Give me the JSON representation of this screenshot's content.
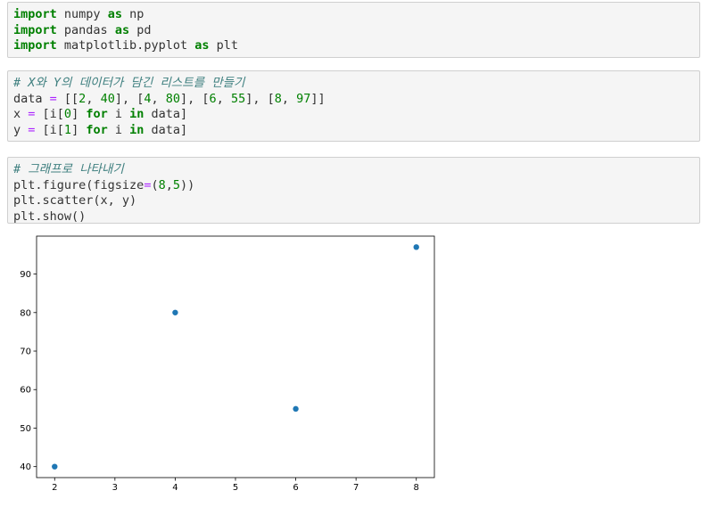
{
  "cells": [
    {
      "lines": [
        [
          {
            "t": "import",
            "c": "kw"
          },
          {
            "t": " numpy ",
            "c": "plain"
          },
          {
            "t": "as",
            "c": "kw"
          },
          {
            "t": " np",
            "c": "plain"
          }
        ],
        [
          {
            "t": "import",
            "c": "kw"
          },
          {
            "t": " pandas ",
            "c": "plain"
          },
          {
            "t": "as",
            "c": "kw"
          },
          {
            "t": " pd",
            "c": "plain"
          }
        ],
        [
          {
            "t": "import",
            "c": "kw"
          },
          {
            "t": " matplotlib.pyplot ",
            "c": "plain"
          },
          {
            "t": "as",
            "c": "kw"
          },
          {
            "t": " plt",
            "c": "plain"
          }
        ]
      ]
    },
    {
      "lines": [
        [
          {
            "t": "# X와 Y의 데이터가 담긴 리스트를 만들기",
            "c": "cmt"
          }
        ],
        [
          {
            "t": "data ",
            "c": "plain"
          },
          {
            "t": "=",
            "c": "op"
          },
          {
            "t": " [[",
            "c": "plain"
          },
          {
            "t": "2",
            "c": "num"
          },
          {
            "t": ", ",
            "c": "plain"
          },
          {
            "t": "40",
            "c": "num"
          },
          {
            "t": "], [",
            "c": "plain"
          },
          {
            "t": "4",
            "c": "num"
          },
          {
            "t": ", ",
            "c": "plain"
          },
          {
            "t": "80",
            "c": "num"
          },
          {
            "t": "], [",
            "c": "plain"
          },
          {
            "t": "6",
            "c": "num"
          },
          {
            "t": ", ",
            "c": "plain"
          },
          {
            "t": "55",
            "c": "num"
          },
          {
            "t": "], [",
            "c": "plain"
          },
          {
            "t": "8",
            "c": "num"
          },
          {
            "t": ", ",
            "c": "plain"
          },
          {
            "t": "97",
            "c": "num"
          },
          {
            "t": "]]",
            "c": "plain"
          }
        ],
        [
          {
            "t": "x ",
            "c": "plain"
          },
          {
            "t": "=",
            "c": "op"
          },
          {
            "t": " [i[",
            "c": "plain"
          },
          {
            "t": "0",
            "c": "num"
          },
          {
            "t": "] ",
            "c": "plain"
          },
          {
            "t": "for",
            "c": "kw"
          },
          {
            "t": " i ",
            "c": "plain"
          },
          {
            "t": "in",
            "c": "kw"
          },
          {
            "t": " data]",
            "c": "plain"
          }
        ],
        [
          {
            "t": "y ",
            "c": "plain"
          },
          {
            "t": "=",
            "c": "op"
          },
          {
            "t": " [i[",
            "c": "plain"
          },
          {
            "t": "1",
            "c": "num"
          },
          {
            "t": "] ",
            "c": "plain"
          },
          {
            "t": "for",
            "c": "kw"
          },
          {
            "t": " i ",
            "c": "plain"
          },
          {
            "t": "in",
            "c": "kw"
          },
          {
            "t": " data]",
            "c": "plain"
          }
        ]
      ]
    },
    {
      "lines": [
        [
          {
            "t": "# 그래프로 나타내기",
            "c": "cmt"
          }
        ],
        [
          {
            "t": "plt.figure(figsize",
            "c": "plain"
          },
          {
            "t": "=",
            "c": "op"
          },
          {
            "t": "(",
            "c": "plain"
          },
          {
            "t": "8",
            "c": "num"
          },
          {
            "t": ",",
            "c": "plain"
          },
          {
            "t": "5",
            "c": "num"
          },
          {
            "t": "))",
            "c": "plain"
          }
        ],
        [
          {
            "t": "plt.scatter(x, y)",
            "c": "plain"
          }
        ],
        [
          {
            "t": "plt.show()",
            "c": "plain"
          }
        ]
      ]
    }
  ],
  "colors": {
    "marker": "#1f77b4",
    "keyword": "#008000",
    "operator": "#aa22ff",
    "comment": "#408080"
  },
  "chart_data": {
    "type": "scatter",
    "x": [
      2,
      4,
      6,
      8
    ],
    "y": [
      40,
      80,
      55,
      97
    ],
    "xlim": [
      1.7,
      8.3
    ],
    "ylim": [
      37.15,
      99.85
    ],
    "xticks": [
      "2",
      "3",
      "4",
      "5",
      "6",
      "7",
      "8"
    ],
    "yticks": [
      "40",
      "50",
      "60",
      "70",
      "80",
      "90"
    ],
    "grid": false,
    "title": "",
    "xlabel": "",
    "ylabel": ""
  }
}
